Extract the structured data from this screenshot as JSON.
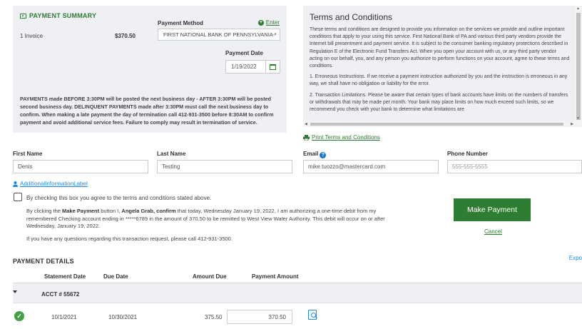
{
  "summary": {
    "title": "PAYMENT SUMMARY",
    "invoice_count": "1 Invoice",
    "invoice_total": "$370.50",
    "payment_method_label": "Payment Method",
    "enter_link": "Enter",
    "payment_method_value": "FIRST NATIONAL BANK OF PENNSYLVANIA *",
    "payment_date_label": "Payment Date",
    "payment_date_value": "1/19/2022",
    "notice": "PAYMENTS made BEFORE 3:30PM will be posted the next business day - AFTER 3:30PM will be posted second business day. DELINQUENT PAYMENTS made after 3:30PM must call the next business day to confirm. When making a late payment the day of termination call 412-931-3500 before 8:30AM to confirm payment and avoid additional service fees. Failure to comply may result in termination of service."
  },
  "terms": {
    "title": "Terms and Conditions",
    "paragraphs": [
      "These terms and conditions are designed to provide you information on the services we provide and outline important conditions that apply to your using this service. First National Bank of PA and various third party vendors provide the Internet bill presentment and payment service. It is subject to the consumer banking regulatory protections described in Regulation E of the Electronic Fund Transfers Act. When you open your account with us, or any third party vendor acting on our behalf, you, and any person you authorize to perform functions on your account, agree to these terms and conditions.",
      "1. Erroneous Instructions. If we receive a payment instruction authorized by you and the instruction is erroneous in any way, we shall have no obligation or liability for the error.",
      "2. Transaction Limitations. Please be aware that certain types of bank accounts have limits on the numbers of transfers or withdrawals that may be made per month. Your bank may place limits on how much exceed such limits, so we recommend you check with your bank to determine what limitations are"
    ],
    "print_link": "Print Terms and Conditions"
  },
  "form": {
    "first_name_label": "First Name",
    "first_name_value": "Denis",
    "last_name_label": "Last Name",
    "last_name_value": "Testing",
    "email_label": "Email",
    "email_value": "mike.tuozzo@mastercard.com",
    "phone_label": "Phone Number",
    "phone_placeholder": "555-555-5555"
  },
  "additional_link": "AdditionalInformationLabel",
  "consent": {
    "text": "By checking this box you agree to the terms and conditions stated above.",
    "auth_prefix": "By clicking the ",
    "auth_button": "Make Payment",
    "auth_mid": " button I, ",
    "auth_name": "Angela Grab, confirm",
    "auth_suffix": " that today, Wednesday January 19, 2022, I am authorizing a one-time debit from my remembered Checking account ending in *****6789 in the amount of 370.50 to be remitted to West View Water Authority. This debit will occur on or after Wednesday, January 19, 2022.",
    "contact": "If you have any questions regarding this transaction request, please call 412-931-3500."
  },
  "actions": {
    "make_payment": "Make Payment",
    "cancel": "Cancel"
  },
  "details": {
    "title": "PAYMENT DETAILS",
    "export": "Expo",
    "columns": [
      "Statement Date",
      "Due Date",
      "Amount Due",
      "Payment Amount"
    ],
    "account": "ACCT # 55672",
    "rows": [
      {
        "statement_date": "10/1/2021",
        "due_date": "10/30/2021",
        "amount_due": "375.50",
        "payment_amount": "370.50"
      }
    ]
  },
  "colors": {
    "brand_green": "#2e7d32",
    "link_blue": "#1e88e5",
    "panel_bg": "#eef0f3"
  },
  "icons": [
    "wallet-icon",
    "plus-circle-icon",
    "chevron-down-icon",
    "calendar-icon",
    "print-icon",
    "help-icon",
    "user-icon",
    "caret-down-icon",
    "check-circle-icon",
    "document-search-icon"
  ]
}
